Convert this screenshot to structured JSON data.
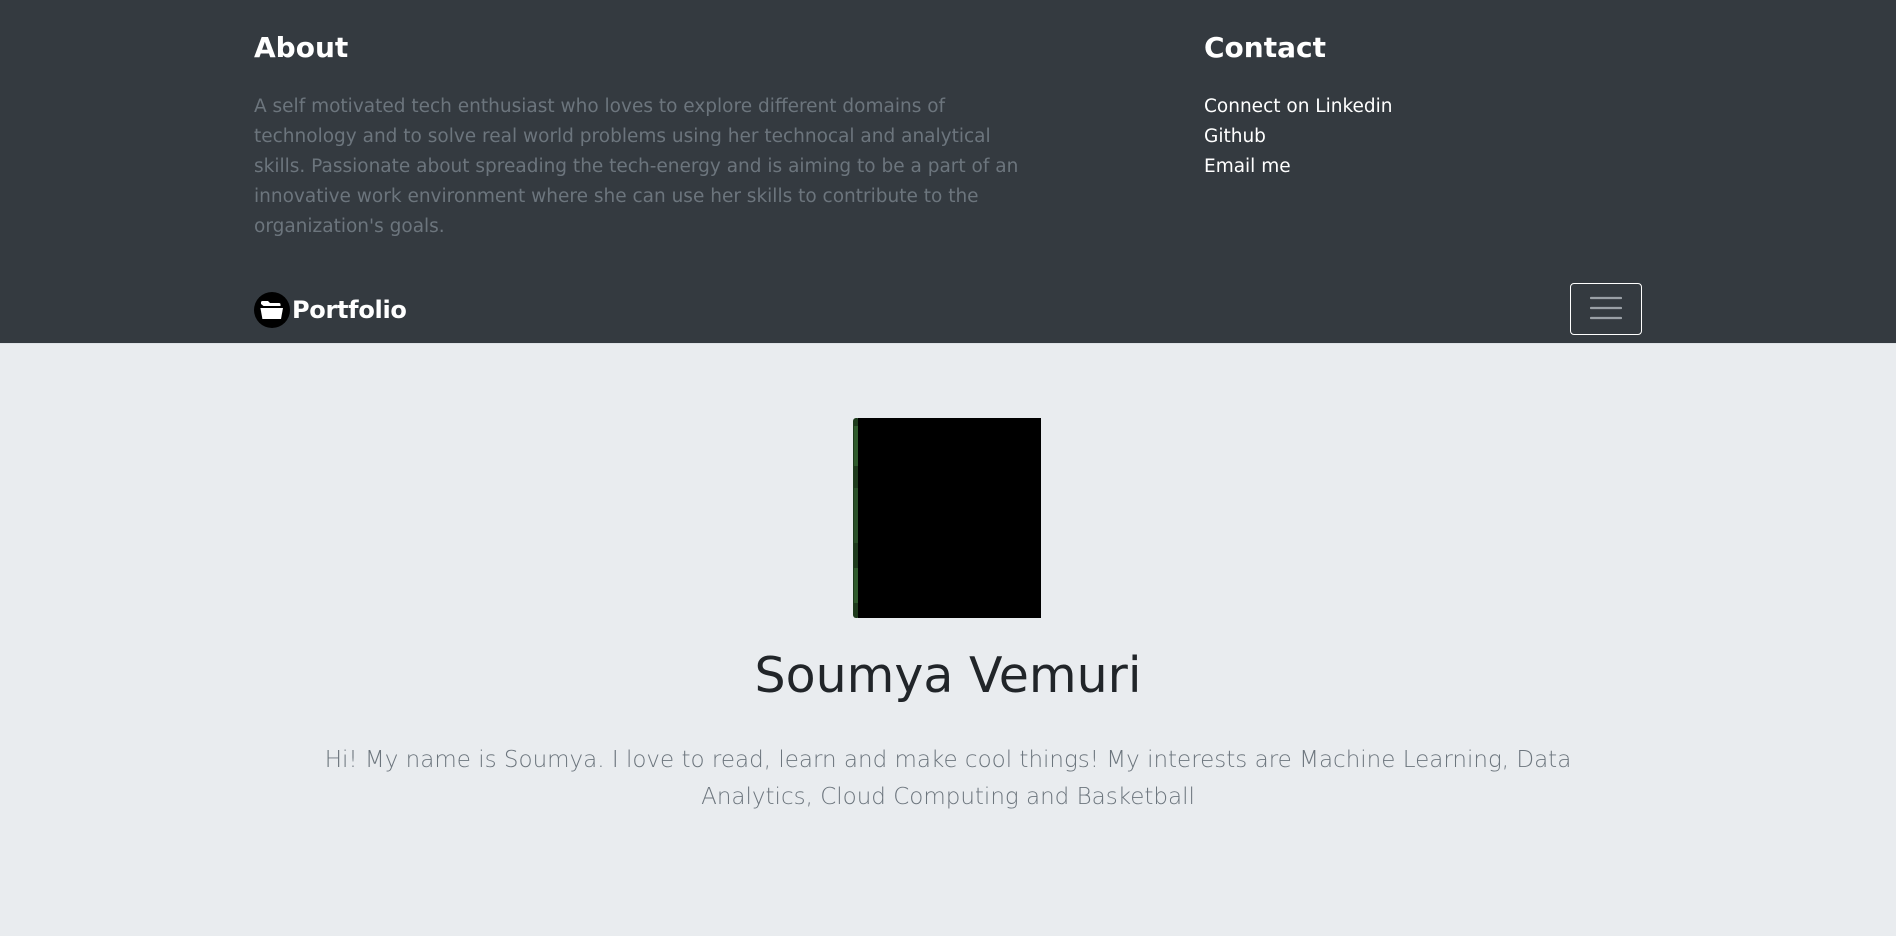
{
  "about": {
    "heading": "About",
    "text": "A self motivated tech enthusiast who loves to explore different domains of technology and to solve real world problems using her technocal and analytical skills. Passionate about spreading the tech-energy and is aiming to be a part of an innovative work environment where she can use her skills to contribute to the organization's goals."
  },
  "contact": {
    "heading": "Contact",
    "links": [
      {
        "label": "Connect on Linkedin"
      },
      {
        "label": "Github"
      },
      {
        "label": "Email me"
      }
    ]
  },
  "navbar": {
    "brand_label": "Portfolio",
    "brand_icon": "folder-icon",
    "toggler_icon": "hamburger-menu-icon"
  },
  "profile": {
    "name": "Soumya Vemuri",
    "lead": "Hi! My name is Soumya. I love to read, learn and make cool things! My interests are Machine Learning, Data Analytics, Cloud Computing and Basketball"
  },
  "colors": {
    "navbar_bg": "#343a40",
    "page_bg": "#e9ecef",
    "muted_text": "#6c757d",
    "heading_text": "#212529"
  }
}
